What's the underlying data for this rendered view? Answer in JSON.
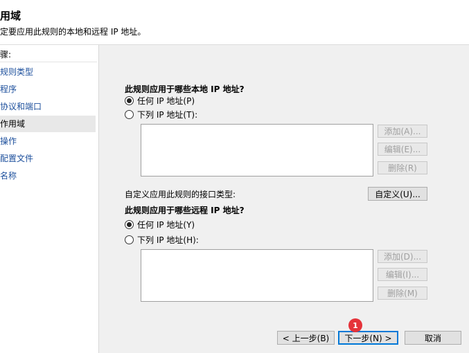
{
  "header": {
    "title": "用域",
    "subtitle": "定要应用此规则的本地和远程 IP 地址。"
  },
  "sidebar": {
    "heading": "骤:",
    "items": [
      {
        "label": "规则类型"
      },
      {
        "label": "程序"
      },
      {
        "label": "协议和端口"
      },
      {
        "label": "作用域"
      },
      {
        "label": "操作"
      },
      {
        "label": "配置文件"
      },
      {
        "label": "名称"
      }
    ]
  },
  "local": {
    "question": "此规则应用于哪些本地 IP 地址?",
    "any_label": "任何 IP 地址(P)",
    "list_label": "下列 IP 地址(T):",
    "selected": "any",
    "add_label": "添加(A)...",
    "edit_label": "编辑(E)...",
    "remove_label": "删除(R)"
  },
  "interface": {
    "label": "自定义应用此规则的接口类型:",
    "button_label": "自定义(U)..."
  },
  "remote": {
    "question": "此规则应用于哪些远程 IP 地址?",
    "any_label": "任何 IP 地址(Y)",
    "list_label": "下列 IP 地址(H):",
    "selected": "any",
    "add_label": "添加(D)...",
    "edit_label": "编辑(I)...",
    "remove_label": "删除(M)"
  },
  "footer": {
    "back_label": "< 上一步(B)",
    "next_label": "下一步(N) >",
    "cancel_label": "取消",
    "badge": "1"
  },
  "colors": {
    "link": "#1c4f9c",
    "panel_bg": "#f0f0f0",
    "badge": "#e5333a",
    "focus": "#0078d7"
  }
}
